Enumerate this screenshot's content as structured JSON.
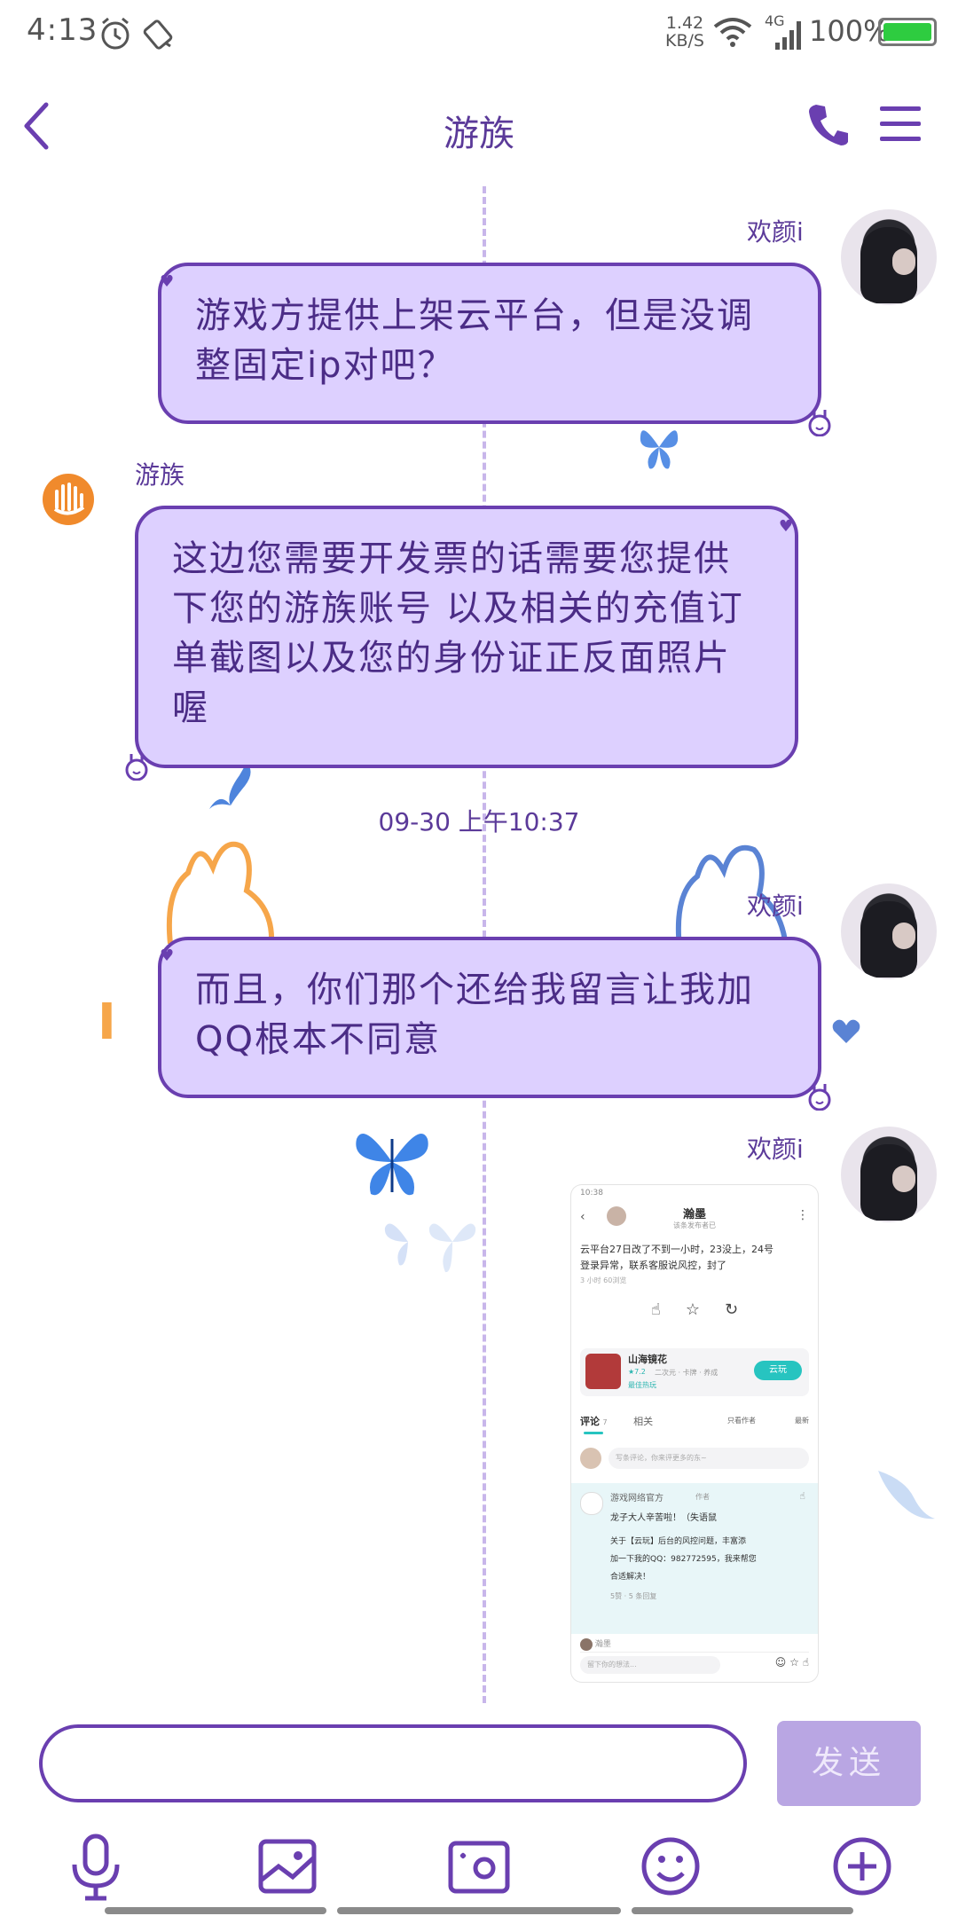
{
  "status_bar": {
    "time": "4:13",
    "net_speed_value": "1.42",
    "net_speed_unit": "KB/S",
    "network": "4G",
    "battery": "100%"
  },
  "header": {
    "back_icon": "chevron-left-icon",
    "title": "游族",
    "call_icon": "phone-icon",
    "menu_icon": "menu-icon"
  },
  "messages": [
    {
      "sender": "欢颜i",
      "side": "right",
      "text": "游戏方提供上架云平台，但是没调整固定ip对吧？"
    },
    {
      "sender": "游族",
      "side": "left",
      "text": "这边您需要开发票的话需要您提供下您的游族账号 以及相关的充值订单截图以及您的身份证正反面照片喔"
    },
    {
      "timestamp": "09-30 上午10:37"
    },
    {
      "sender": "欢颜i",
      "side": "right",
      "text": "而且，你们那个还给我留言让我加QQ根本不同意"
    },
    {
      "sender": "欢颜i",
      "side": "right",
      "type": "image"
    }
  ],
  "screenshot": {
    "status": "10:38",
    "title": "瀚墨",
    "subtitle": "该条发布者已",
    "post_line1": "云平台27日改了不到一小时，23没上，24号",
    "post_line2": "登录异常，联系客服说风控，封了",
    "post_meta": "3 小时   60浏览",
    "game_name": "山海镜花",
    "game_score": "★7.2",
    "game_tags": "二次元 · 卡牌 · 养成",
    "game_hot": "最佳热玩",
    "game_button": "云玩",
    "tab_comments": "评论",
    "tab_comments_count": "7",
    "tab_likes": "相关",
    "filter1": "只看作者",
    "filter2": "最新",
    "comment_placeholder": "写条评论，你来评更多的东~",
    "official_name": "游戏网络官方",
    "official_tag": "作者",
    "official_line1": "龙子大人辛苦啦！（失语鼠",
    "official_line2": "关于【云玩】后台的风控问题，丰富添",
    "official_line3": "加一下我的QQ：982772595，我来帮您",
    "official_line4": "合适解决！",
    "official_meta": "5赞 · 5 条回复",
    "reply_name": "瀚墨",
    "bottom_placeholder": "留下你的想法..."
  },
  "input_bar": {
    "text": "",
    "send_label": "发送"
  },
  "toolbar": [
    "microphone-icon",
    "image-icon",
    "camera-icon",
    "emoji-icon",
    "plus-circle-icon"
  ],
  "decorations": {
    "letter": "I"
  },
  "colors": {
    "accent": "#6a3fb0",
    "bubble": "#ddd0ff",
    "timeline": "#c8b6ea",
    "send_button": "#b9a6e3"
  }
}
